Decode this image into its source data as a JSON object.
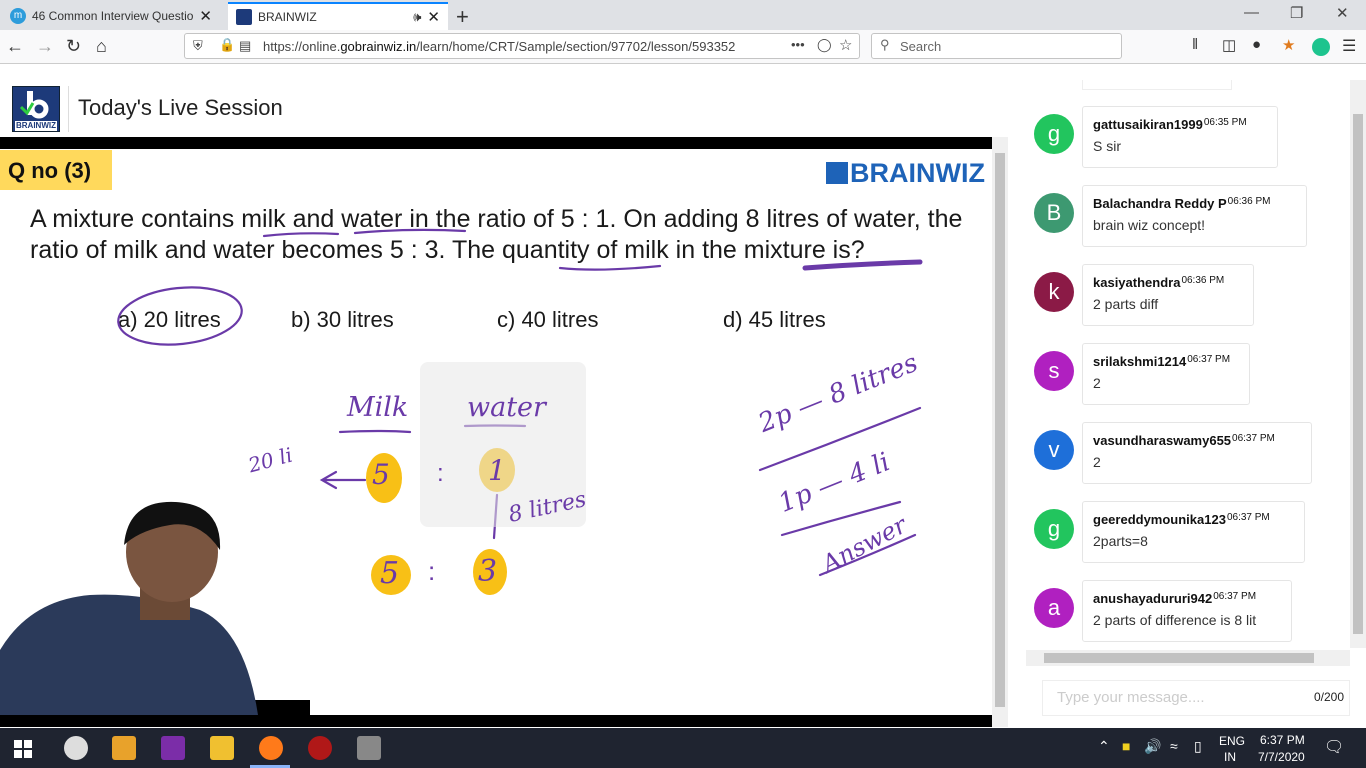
{
  "browser": {
    "tabs": [
      {
        "title": "46 Common Interview Questior",
        "favicon_color": "#2d9cdb",
        "favicon_letter": "m",
        "close": "✕"
      },
      {
        "title": "BRAINWIZ",
        "favicon_color": "#1d3a7a",
        "audio": "🕪",
        "close": "✕"
      }
    ],
    "new_tab": "+",
    "window_controls": {
      "minimize": "—",
      "restore": "❐",
      "close": "✕"
    },
    "url_prefix": "https://online.",
    "url_domain": "gobrainwiz.in",
    "url_path": "/learn/home/CRT/Sample/section/97702/lesson/593352",
    "more": "•••",
    "search_placeholder": "Search"
  },
  "page": {
    "logo_text": "BRAINWIZ",
    "session_title": "Today's Live Session"
  },
  "slide": {
    "qno": "Q no (3)",
    "brand": "BRAINWIZ",
    "question": "A mixture contains milk and water in the ratio of 5 : 1. On adding 8 litres of water, the ratio of milk and water becomes 5 : 3. The quantity of milk in the mixture is?",
    "options": [
      "a) 20 litres",
      "b) 30 litres",
      "c) 40 litres",
      "d) 45 litres"
    ],
    "handwriting": {
      "milk": "Milk",
      "water": "water",
      "left_note": "20 li",
      "ratio1_a": "5",
      "ratio1_b": "1",
      "ratio_colon": ":",
      "add": "8 litres",
      "ratio2_a": "5",
      "ratio2_b": "3",
      "right1": "2p — 8 litres",
      "right2": "1p — 4 li",
      "answer": "Answer"
    }
  },
  "chat": {
    "messages": [
      {
        "initial": "g",
        "color": "#22c55e",
        "user": "gattusaikiran1999",
        "time": "06:35 PM",
        "text": "S sir"
      },
      {
        "initial": "B",
        "color": "#3d9971",
        "user": "Balachandra Reddy P",
        "time": "06:36 PM",
        "text": "brain wiz concept!"
      },
      {
        "initial": "k",
        "color": "#8b1a46",
        "user": "kasiyathendra",
        "time": "06:36 PM",
        "text": "2 parts diff"
      },
      {
        "initial": "s",
        "color": "#b020c0",
        "user": "srilakshmi1214",
        "time": "06:37 PM",
        "text": "2"
      },
      {
        "initial": "v",
        "color": "#1e6fd9",
        "user": "vasundharaswamy655",
        "time": "06:37 PM",
        "text": "2"
      },
      {
        "initial": "g",
        "color": "#22c55e",
        "user": "geereddymounika123",
        "time": "06:37 PM",
        "text": "2parts=8"
      },
      {
        "initial": "a",
        "color": "#b020c0",
        "user": "anushayadururi942",
        "time": "06:37 PM",
        "text": "2 parts of difference is 8 lit"
      }
    ],
    "input_placeholder": "Type your message....",
    "char_count": "0/200"
  },
  "taskbar": {
    "lang1": "ENG",
    "lang2": "IN",
    "time": "6:37 PM",
    "date": "7/7/2020"
  }
}
